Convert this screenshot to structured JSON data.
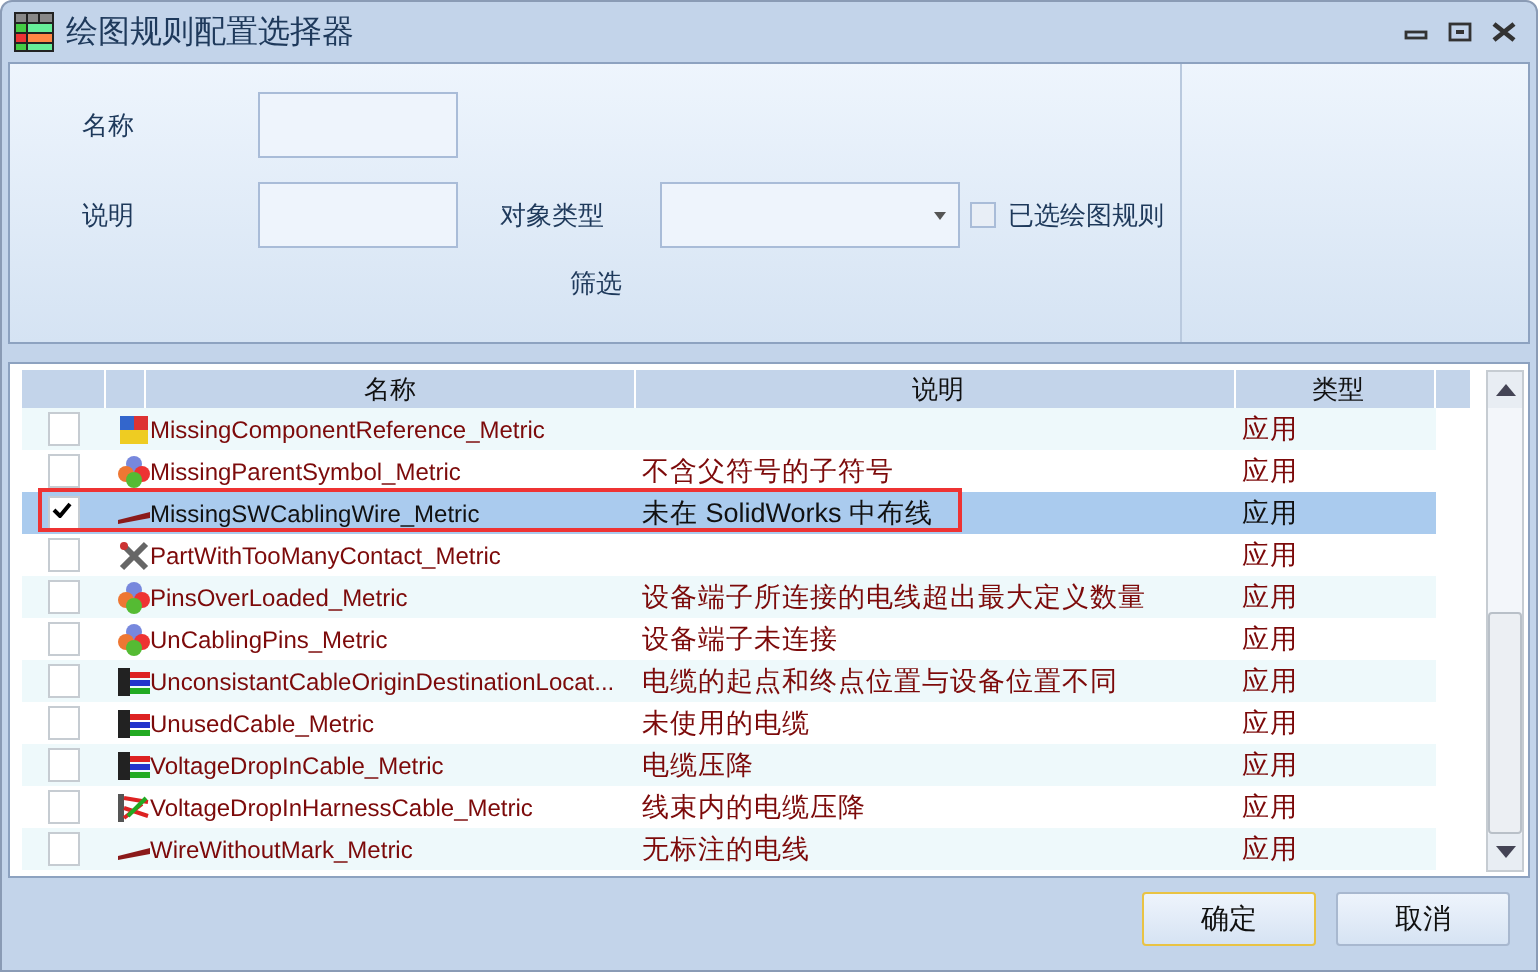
{
  "window": {
    "title": "绘图规则配置选择器"
  },
  "filter": {
    "name_label": "名称",
    "description_label": "说明",
    "type_label": "对象类型",
    "selected_only": {
      "label": "已选绘图规则",
      "checked": false
    },
    "group_label": "筛选"
  },
  "table": {
    "columns": [
      "名称",
      "说明",
      "类型"
    ],
    "rows": [
      {
        "checked": false,
        "selected": false,
        "outlined": false,
        "kind": "blocks",
        "name": "MissingComponentReference_Metric",
        "description": "",
        "type": "应用"
      },
      {
        "checked": false,
        "selected": false,
        "outlined": false,
        "kind": "cubes",
        "name": "MissingParentSymbol_Metric",
        "description": "不含父符号的子符号",
        "type": "应用"
      },
      {
        "checked": true,
        "selected": true,
        "outlined": true,
        "kind": "wire",
        "name": "MissingSWCablingWire_Metric",
        "description": "未在 SolidWorks 中布线",
        "type": "应用"
      },
      {
        "checked": false,
        "selected": false,
        "outlined": false,
        "kind": "tools",
        "name": "PartWithTooManyContact_Metric",
        "description": "",
        "type": "应用"
      },
      {
        "checked": false,
        "selected": false,
        "outlined": false,
        "kind": "cubes",
        "name": "PinsOverLoaded_Metric",
        "description": "设备端子所连接的电线超出最大定义数量",
        "type": "应用"
      },
      {
        "checked": false,
        "selected": false,
        "outlined": false,
        "kind": "cubes",
        "name": "UnCablingPins_Metric",
        "description": "设备端子未连接",
        "type": "应用"
      },
      {
        "checked": false,
        "selected": false,
        "outlined": false,
        "kind": "cable",
        "name": "UnconsistantCableOriginDestinationLocat...",
        "description": "电缆的起点和终点位置与设备位置不同",
        "type": "应用"
      },
      {
        "checked": false,
        "selected": false,
        "outlined": false,
        "kind": "cable",
        "name": "UnusedCable_Metric",
        "description": "未使用的电缆",
        "type": "应用"
      },
      {
        "checked": false,
        "selected": false,
        "outlined": false,
        "kind": "cable",
        "name": "VoltageDropInCable_Metric",
        "description": "电缆压降",
        "type": "应用"
      },
      {
        "checked": false,
        "selected": false,
        "outlined": false,
        "kind": "harness",
        "name": "VoltageDropInHarnessCable_Metric",
        "description": "线束内的电缆压降",
        "type": "应用"
      },
      {
        "checked": false,
        "selected": false,
        "outlined": false,
        "kind": "wire",
        "name": "WireWithoutMark_Metric",
        "description": "无标注的电线",
        "type": "应用"
      }
    ]
  },
  "buttons": {
    "ok": "确定",
    "cancel": "取消"
  }
}
